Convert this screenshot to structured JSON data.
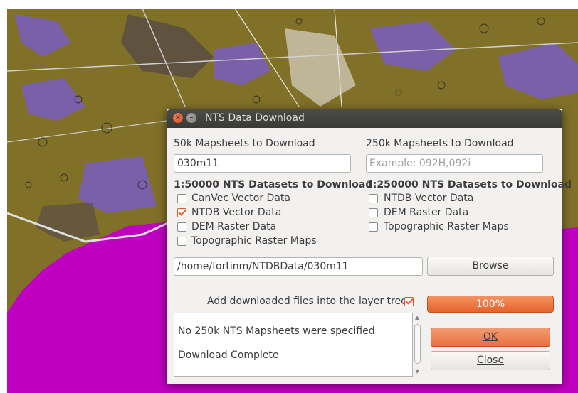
{
  "dialog": {
    "title": "NTS Data Download",
    "label_50k": "50k Mapsheets to Download",
    "value_50k": "030m11",
    "label_250k": "250k Mapsheets to Download",
    "placeholder_250k": "Example: 092H,092i",
    "datasets_50k": {
      "heading": "1:50000 NTS Datasets to Download",
      "items": [
        {
          "label": "CanVec Vector Data",
          "checked": false
        },
        {
          "label": "NTDB Vector Data",
          "checked": true
        },
        {
          "label": "DEM Raster Data",
          "checked": false
        },
        {
          "label": "Topographic Raster Maps",
          "checked": false
        }
      ]
    },
    "datasets_250k": {
      "heading": "1:250000 NTS Datasets to Download",
      "items": [
        {
          "label": "NTDB Vector Data",
          "checked": false
        },
        {
          "label": "DEM Raster Data",
          "checked": false
        },
        {
          "label": "Topographic Raster Maps",
          "checked": false
        }
      ]
    },
    "output_path": "/home/fortinm/NTDBData/030m11",
    "browse_label": "Browse",
    "add_to_tree_label": "Add downloaded files into the layer tree",
    "add_to_tree_checked": true,
    "progress_text": "100%",
    "progress_value": 1.0,
    "log_lines": [
      "No 250k NTS Mapsheets were specified",
      "Download Complete"
    ],
    "ok_label": "OK",
    "close_label": "Close"
  },
  "colors": {
    "accent": "#e9703d",
    "map_water": "#c000c0",
    "map_land": "#807028",
    "map_lake": "#7a60a8",
    "title_bar": "#3c3b37"
  }
}
